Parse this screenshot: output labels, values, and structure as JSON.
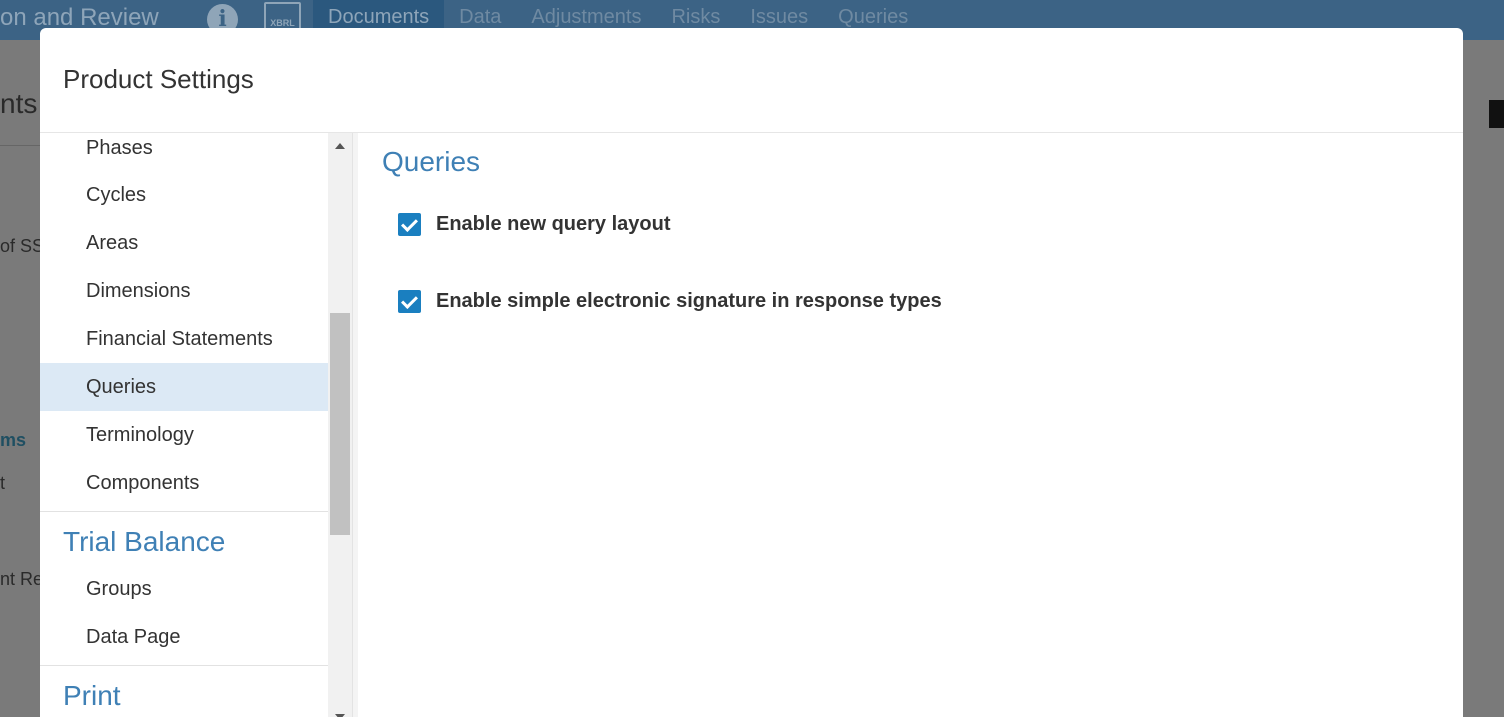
{
  "background": {
    "app_title": "on and Review",
    "info_icon_glyph": "i",
    "xbrl_label": "XBRL",
    "nav": [
      "Documents",
      "Data",
      "Adjustments",
      "Risks",
      "Issues",
      "Queries"
    ],
    "active_nav": "Documents",
    "page_heading": "nts",
    "left_texts": [
      "of SS",
      "ms",
      "t",
      "nt Re"
    ]
  },
  "modal": {
    "title": "Product Settings",
    "sidebar": {
      "items_group1": [
        "Phases",
        "Cycles",
        "Areas",
        "Dimensions",
        "Financial Statements",
        "Queries",
        "Terminology",
        "Components"
      ],
      "active_item": "Queries",
      "section_trial_balance": "Trial Balance",
      "items_group2": [
        "Groups",
        "Data Page"
      ],
      "section_print": "Print"
    },
    "content": {
      "title": "Queries",
      "options": [
        {
          "label": "Enable new query layout",
          "checked": true
        },
        {
          "label": "Enable simple electronic signature in response types",
          "checked": true
        }
      ]
    }
  },
  "colors": {
    "accent": "#3f80b5",
    "checkbox": "#1a7fc0",
    "active_row": "#dce9f5",
    "topbar": "#3c6385"
  }
}
